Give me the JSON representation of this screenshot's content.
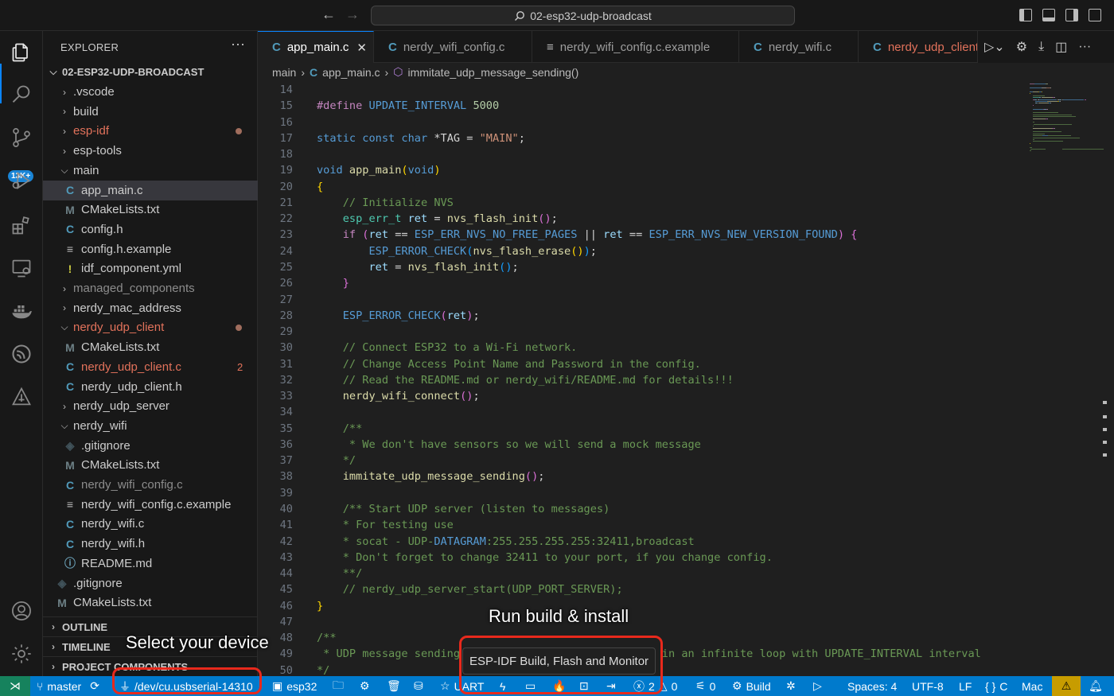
{
  "titlebar": {
    "search_text": "02-esp32-udp-broadcast"
  },
  "activity_bar": {
    "source_control_badge": "13K+"
  },
  "explorer": {
    "title": "EXPLORER",
    "root": "02-ESP32-UDP-BROADCAST",
    "items": [
      {
        "label": ".vscode",
        "type": "folder",
        "expanded": false,
        "indent": 1
      },
      {
        "label": "build",
        "type": "folder",
        "expanded": false,
        "indent": 1
      },
      {
        "label": "esp-idf",
        "type": "folder",
        "expanded": false,
        "indent": 1,
        "modified": true
      },
      {
        "label": "esp-tools",
        "type": "folder",
        "expanded": false,
        "indent": 1
      },
      {
        "label": "main",
        "type": "folder",
        "expanded": true,
        "indent": 1
      },
      {
        "label": "app_main.c",
        "type": "c",
        "indent": 2,
        "selected": true
      },
      {
        "label": "CMakeLists.txt",
        "type": "cmake",
        "indent": 2
      },
      {
        "label": "config.h",
        "type": "c",
        "indent": 2
      },
      {
        "label": "config.h.example",
        "type": "text",
        "indent": 2
      },
      {
        "label": "idf_component.yml",
        "type": "yml",
        "indent": 2
      },
      {
        "label": "managed_components",
        "type": "folder",
        "expanded": false,
        "indent": 1,
        "dim": true
      },
      {
        "label": "nerdy_mac_address",
        "type": "folder",
        "expanded": false,
        "indent": 1
      },
      {
        "label": "nerdy_udp_client",
        "type": "folder",
        "expanded": true,
        "indent": 1,
        "modified": true
      },
      {
        "label": "CMakeLists.txt",
        "type": "cmake",
        "indent": 2
      },
      {
        "label": "nerdy_udp_client.c",
        "type": "c",
        "indent": 2,
        "errors": "2"
      },
      {
        "label": "nerdy_udp_client.h",
        "type": "c",
        "indent": 2
      },
      {
        "label": "nerdy_udp_server",
        "type": "folder",
        "expanded": false,
        "indent": 1
      },
      {
        "label": "nerdy_wifi",
        "type": "folder",
        "expanded": true,
        "indent": 1
      },
      {
        "label": ".gitignore",
        "type": "git",
        "indent": 2
      },
      {
        "label": "CMakeLists.txt",
        "type": "cmake",
        "indent": 2
      },
      {
        "label": "nerdy_wifi_config.c",
        "type": "c",
        "indent": 2,
        "dim": true
      },
      {
        "label": "nerdy_wifi_config.c.example",
        "type": "text",
        "indent": 2
      },
      {
        "label": "nerdy_wifi.c",
        "type": "c",
        "indent": 2
      },
      {
        "label": "nerdy_wifi.h",
        "type": "c",
        "indent": 2
      },
      {
        "label": "README.md",
        "type": "info",
        "indent": 2
      },
      {
        "label": ".gitignore",
        "type": "git",
        "indent": 1
      },
      {
        "label": "CMakeLists.txt",
        "type": "cmake",
        "indent": 1
      }
    ],
    "sections": [
      "OUTLINE",
      "TIMELINE",
      "PROJECT COMPONENTS"
    ]
  },
  "tabs": [
    {
      "label": "app_main.c",
      "icon": "C",
      "active": true
    },
    {
      "label": "nerdy_wifi_config.c",
      "icon": "C"
    },
    {
      "label": "nerdy_wifi_config.c.example",
      "icon": "≡"
    },
    {
      "label": "nerdy_wifi.c",
      "icon": "C"
    },
    {
      "label": "nerdy_udp_client",
      "icon": "C",
      "modified": true
    }
  ],
  "breadcrumb": {
    "folder": "main",
    "file": "app_main.c",
    "symbol": "immitate_udp_message_sending()"
  },
  "code": {
    "lines": [
      {
        "n": "14",
        "segs": []
      },
      {
        "n": "15",
        "segs": [
          [
            "#define ",
            "#c586c0"
          ],
          [
            "UPDATE_INTERVAL ",
            "#569cd6"
          ],
          [
            "5000",
            "#b5cea8"
          ]
        ]
      },
      {
        "n": "16",
        "segs": []
      },
      {
        "n": "17",
        "segs": [
          [
            "static const char ",
            "#569cd6"
          ],
          [
            "*TAG = ",
            "#d4d4d4"
          ],
          [
            "\"MAIN\"",
            "#ce9178"
          ],
          [
            ";",
            "#d4d4d4"
          ]
        ]
      },
      {
        "n": "18",
        "segs": []
      },
      {
        "n": "19",
        "segs": [
          [
            "void ",
            "#569cd6"
          ],
          [
            "app_main",
            "#dcdcaa"
          ],
          [
            "(",
            "#ffd700"
          ],
          [
            "void",
            "#569cd6"
          ],
          [
            ")",
            "#ffd700"
          ]
        ]
      },
      {
        "n": "20",
        "segs": [
          [
            "{",
            "#ffd700"
          ]
        ]
      },
      {
        "n": "21",
        "segs": [
          [
            "    // Initialize NVS",
            "#6a9955"
          ]
        ]
      },
      {
        "n": "22",
        "segs": [
          [
            "    esp_err_t ",
            "#4ec9b0"
          ],
          [
            "ret",
            "#9cdcfe"
          ],
          [
            " = ",
            "#d4d4d4"
          ],
          [
            "nvs_flash_init",
            "#dcdcaa"
          ],
          [
            "()",
            "#da70d6"
          ],
          [
            ";",
            "#d4d4d4"
          ]
        ]
      },
      {
        "n": "23",
        "segs": [
          [
            "    if ",
            "#c586c0"
          ],
          [
            "(",
            "#da70d6"
          ],
          [
            "ret",
            "#9cdcfe"
          ],
          [
            " == ",
            "#d4d4d4"
          ],
          [
            "ESP_ERR_NVS_NO_FREE_PAGES",
            "#569cd6"
          ],
          [
            " || ",
            "#d4d4d4"
          ],
          [
            "ret",
            "#9cdcfe"
          ],
          [
            " == ",
            "#d4d4d4"
          ],
          [
            "ESP_ERR_NVS_NEW_VERSION_FOUND",
            "#569cd6"
          ],
          [
            ") {",
            "#da70d6"
          ]
        ]
      },
      {
        "n": "24",
        "segs": [
          [
            "        ESP_ERROR_CHECK",
            "#569cd6"
          ],
          [
            "(",
            "#179fff"
          ],
          [
            "nvs_flash_erase",
            "#dcdcaa"
          ],
          [
            "()",
            "#ffd700"
          ],
          [
            ")",
            "#179fff"
          ],
          [
            ";",
            "#d4d4d4"
          ]
        ]
      },
      {
        "n": "25",
        "segs": [
          [
            "        ret",
            "#9cdcfe"
          ],
          [
            " = ",
            "#d4d4d4"
          ],
          [
            "nvs_flash_init",
            "#dcdcaa"
          ],
          [
            "()",
            "#179fff"
          ],
          [
            ";",
            "#d4d4d4"
          ]
        ]
      },
      {
        "n": "26",
        "segs": [
          [
            "    }",
            "#da70d6"
          ]
        ]
      },
      {
        "n": "27",
        "segs": []
      },
      {
        "n": "28",
        "segs": [
          [
            "    ESP_ERROR_CHECK",
            "#569cd6"
          ],
          [
            "(",
            "#da70d6"
          ],
          [
            "ret",
            "#9cdcfe"
          ],
          [
            ")",
            "#da70d6"
          ],
          [
            ";",
            "#d4d4d4"
          ]
        ]
      },
      {
        "n": "29",
        "segs": []
      },
      {
        "n": "30",
        "segs": [
          [
            "    // Connect ESP32 to a Wi-Fi network.",
            "#6a9955"
          ]
        ]
      },
      {
        "n": "31",
        "segs": [
          [
            "    // Change Access Point Name and Password in the config.",
            "#6a9955"
          ]
        ]
      },
      {
        "n": "32",
        "segs": [
          [
            "    // Read the README.md or nerdy_wifi/README.md for details!!!",
            "#6a9955"
          ]
        ]
      },
      {
        "n": "33",
        "segs": [
          [
            "    nerdy_wifi_connect",
            "#dcdcaa"
          ],
          [
            "()",
            "#da70d6"
          ],
          [
            ";",
            "#d4d4d4"
          ]
        ]
      },
      {
        "n": "34",
        "segs": []
      },
      {
        "n": "35",
        "segs": [
          [
            "    /**",
            "#6a9955"
          ]
        ]
      },
      {
        "n": "36",
        "segs": [
          [
            "     * We don't have sensors so we will send a mock message",
            "#6a9955"
          ]
        ]
      },
      {
        "n": "37",
        "segs": [
          [
            "    */",
            "#6a9955"
          ]
        ]
      },
      {
        "n": "38",
        "segs": [
          [
            "    immitate_udp_message_sending",
            "#dcdcaa"
          ],
          [
            "()",
            "#da70d6"
          ],
          [
            ";",
            "#d4d4d4"
          ]
        ]
      },
      {
        "n": "39",
        "segs": []
      },
      {
        "n": "40",
        "segs": [
          [
            "    /** Start UDP server (listen to messages)",
            "#6a9955"
          ]
        ]
      },
      {
        "n": "41",
        "segs": [
          [
            "    * For testing use",
            "#6a9955"
          ]
        ]
      },
      {
        "n": "42",
        "segs": [
          [
            "    * socat - UDP-",
            "#6a9955"
          ],
          [
            "DATAGRAM",
            "#569cd6"
          ],
          [
            ":255.255.255.255:32411,broadcast",
            "#6a9955"
          ]
        ]
      },
      {
        "n": "43",
        "segs": [
          [
            "    * Don't forget to change 32411 to your port, if you change config.",
            "#6a9955"
          ]
        ]
      },
      {
        "n": "44",
        "segs": [
          [
            "    **/",
            "#6a9955"
          ]
        ]
      },
      {
        "n": "45",
        "segs": [
          [
            "    // nerdy_udp_server_start(UDP_PORT_SERVER);",
            "#6a9955"
          ]
        ]
      },
      {
        "n": "46",
        "segs": [
          [
            "}",
            "#ffd700"
          ]
        ]
      },
      {
        "n": "47",
        "segs": []
      },
      {
        "n": "48",
        "segs": [
          [
            "/**",
            "#6a9955"
          ]
        ]
      },
      {
        "n": "49",
        "segs": [
          [
            " * UDP message sending",
            "#6a9955"
          ],
          [
            "                       ",
            "#6a9955"
          ],
          [
            "be sent in an infinite loop with UPDATE_INTERVAL interval",
            "#6a9955"
          ]
        ]
      },
      {
        "n": "50",
        "segs": [
          [
            "*/",
            "#6a9955"
          ]
        ]
      }
    ]
  },
  "tooltip": {
    "text": "ESP-IDF Build, Flash and Monitor"
  },
  "annotations": {
    "run_build": "Run build & install",
    "select_device": "Select your device"
  },
  "statusbar": {
    "branch": "master",
    "port": "/dev/cu.usbserial-14310",
    "target": "esp32",
    "uart": "UART",
    "errors": "2",
    "warnings": "0",
    "ports": "0",
    "build": "Build",
    "spaces": "Spaces: 4",
    "encoding": "UTF-8",
    "eol": "LF",
    "language": "C",
    "platform": "Mac"
  },
  "colors": {
    "accent": "#007acc",
    "remote": "#16825d",
    "annotation_red": "#e8291c",
    "warning_bg": "#c79c00"
  }
}
